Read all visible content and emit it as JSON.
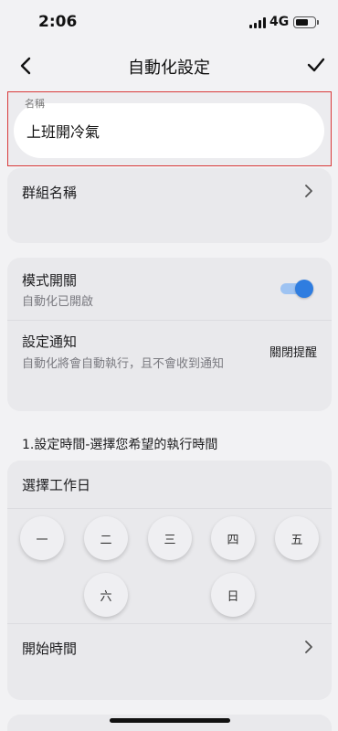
{
  "status_bar": {
    "time": "2:06",
    "network": "4G"
  },
  "nav": {
    "title": "自動化設定",
    "back_icon": "chevron-left-icon",
    "confirm_icon": "checkmark-icon"
  },
  "name_field": {
    "label": "名稱",
    "value": "上班開冷氣"
  },
  "group": {
    "label": "群組名稱"
  },
  "mode": {
    "title": "模式開關",
    "subtitle": "自動化已開啟",
    "enabled": true
  },
  "notification": {
    "title": "設定通知",
    "subtitle": "自動化將會自動執行，且不會收到通知",
    "action": "關閉提醒"
  },
  "schedule": {
    "heading": "1.設定時間-選擇您希望的執行時間",
    "workday_label": "選擇工作日",
    "days": [
      "一",
      "二",
      "三",
      "四",
      "五",
      "六",
      "日"
    ],
    "start_time_label": "開始時間"
  },
  "colors": {
    "accent": "#2f7de0",
    "highlight_border": "#d93a3a",
    "background": "#f2f2f4",
    "card": "#e9e9ec"
  }
}
